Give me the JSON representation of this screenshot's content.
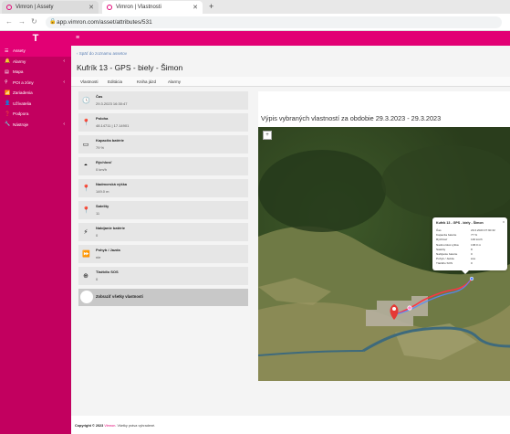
{
  "browser": {
    "tabs": [
      {
        "title": "Vimron | Assety",
        "active": false
      },
      {
        "title": "Vimron | Vlastnosti",
        "active": true
      }
    ],
    "new_tab": "+",
    "url": "app.vimron.com/asset/attributes/531"
  },
  "sidebar": {
    "logo": "T",
    "items": [
      {
        "label": "Assety",
        "icon": "list-icon",
        "active": true,
        "chevron": false
      },
      {
        "label": "Alarmy",
        "icon": "bell-icon",
        "active": false,
        "chevron": true
      },
      {
        "label": "Mapa",
        "icon": "map-icon",
        "active": false,
        "chevron": false
      },
      {
        "label": "POI a zóny",
        "icon": "pin-icon",
        "active": false,
        "chevron": true
      },
      {
        "label": "Zariadenia",
        "icon": "wifi-icon",
        "active": false,
        "chevron": false
      },
      {
        "label": "Užívatelia",
        "icon": "user-icon",
        "active": false,
        "chevron": false
      },
      {
        "label": "Podpora",
        "icon": "help-icon",
        "active": false,
        "chevron": false
      },
      {
        "label": "Nástroje",
        "icon": "wrench-icon",
        "active": false,
        "chevron": true
      }
    ]
  },
  "main": {
    "back_link": "Späť do zoznamu assetov",
    "title": "Kufrík 13 - GPS - biely - Šimon",
    "tabs": [
      "Vlastnosti",
      "Editácia",
      "Kniha jázd",
      "Alarmy"
    ],
    "properties": [
      {
        "label": "Čas",
        "value": "29.3.2023 16:30:47",
        "icon": "clock-icon"
      },
      {
        "label": "Poloha",
        "value": "48.14711 | 17.14901",
        "icon": "location-pin-icon"
      },
      {
        "label": "Kapacita batérie",
        "value": "79 %",
        "icon": "battery-icon"
      },
      {
        "label": "Rýchlosť",
        "value": "0 km/h",
        "icon": "speedometer-icon"
      },
      {
        "label": "Nadmorská výška",
        "value": "149.0 m",
        "icon": "altitude-pin-icon"
      },
      {
        "label": "Satelity",
        "value": "11",
        "icon": "satellite-pin-icon"
      },
      {
        "label": "Nabíjanie batérie",
        "value": "0",
        "icon": "lightning-icon"
      },
      {
        "label": "Pohyb / Jazda",
        "value": "nie",
        "icon": "fast-forward-icon"
      },
      {
        "label": "Tlačidlo SOS",
        "value": "0",
        "icon": "lifebuoy-icon"
      }
    ],
    "show_all_label": "Zobraziť všetky vlastnosti"
  },
  "map_panel": {
    "title": "Výpis vybraných vlastností za obdobie 29.3.2023 - 29.3.2023",
    "zoom_control": "+",
    "popup": {
      "title": "Kufrík 13 - GPS - biely - Šimon",
      "close": "x",
      "rows": [
        {
          "label": "Čas",
          "value": "29.3.2023 07:30:32"
        },
        {
          "label": "Kapacita batérie",
          "value": "77 %"
        },
        {
          "label": "Rýchlosť",
          "value": "140 km/h"
        },
        {
          "label": "Nadmorská výška",
          "value": "138.0 m"
        },
        {
          "label": "Satelity",
          "value": "8"
        },
        {
          "label": "Nabíjanie batérie",
          "value": "0"
        },
        {
          "label": "Pohyb / Jazda",
          "value": "áno"
        },
        {
          "label": "Tlačidlo SOS",
          "value": "0"
        }
      ]
    }
  },
  "footer": {
    "copyright": "Copyright © 2023",
    "brand": "Vimron",
    "rights": ". Všetky práva vyhradené."
  },
  "colors": {
    "brand_magenta": "#e20074",
    "sidebar": "#c2005f"
  }
}
